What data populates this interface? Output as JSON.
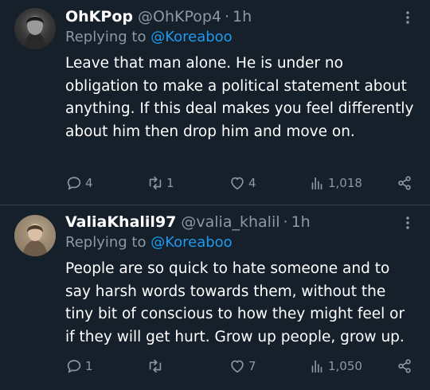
{
  "tweets": [
    {
      "name": "OhKPop",
      "handle": "@OhKPop4",
      "separator": "·",
      "time": "1h",
      "reply_prefix": "Replying to",
      "reply_to": "@Koreaboo",
      "text": "Leave that man alone. He is under no obligation to make a political statement about anything. If this deal makes you feel differently about him then drop him and move on.",
      "replies": "4",
      "retweets": "1",
      "likes": "4",
      "views": "1,018"
    },
    {
      "name": "ValiaKhalil97",
      "handle": "@valia_khalil",
      "separator": "·",
      "time": "1h",
      "reply_prefix": "Replying to",
      "reply_to": "@Koreaboo",
      "text": "People are so quick to hate someone and to say harsh words towards them, without the tiny bit of conscious to how they might feel or if they will get hurt. Grow up people, grow up.",
      "replies": "1",
      "retweets": "",
      "likes": "7",
      "views": "1,050"
    }
  ],
  "colors": {
    "background": "#15202b",
    "divider": "#38444d",
    "secondary_text": "#8b98a5",
    "mention": "#1d9bf0"
  },
  "icons": [
    "more-icon",
    "reply-icon",
    "retweet-icon",
    "like-icon",
    "views-icon",
    "share-icon"
  ]
}
